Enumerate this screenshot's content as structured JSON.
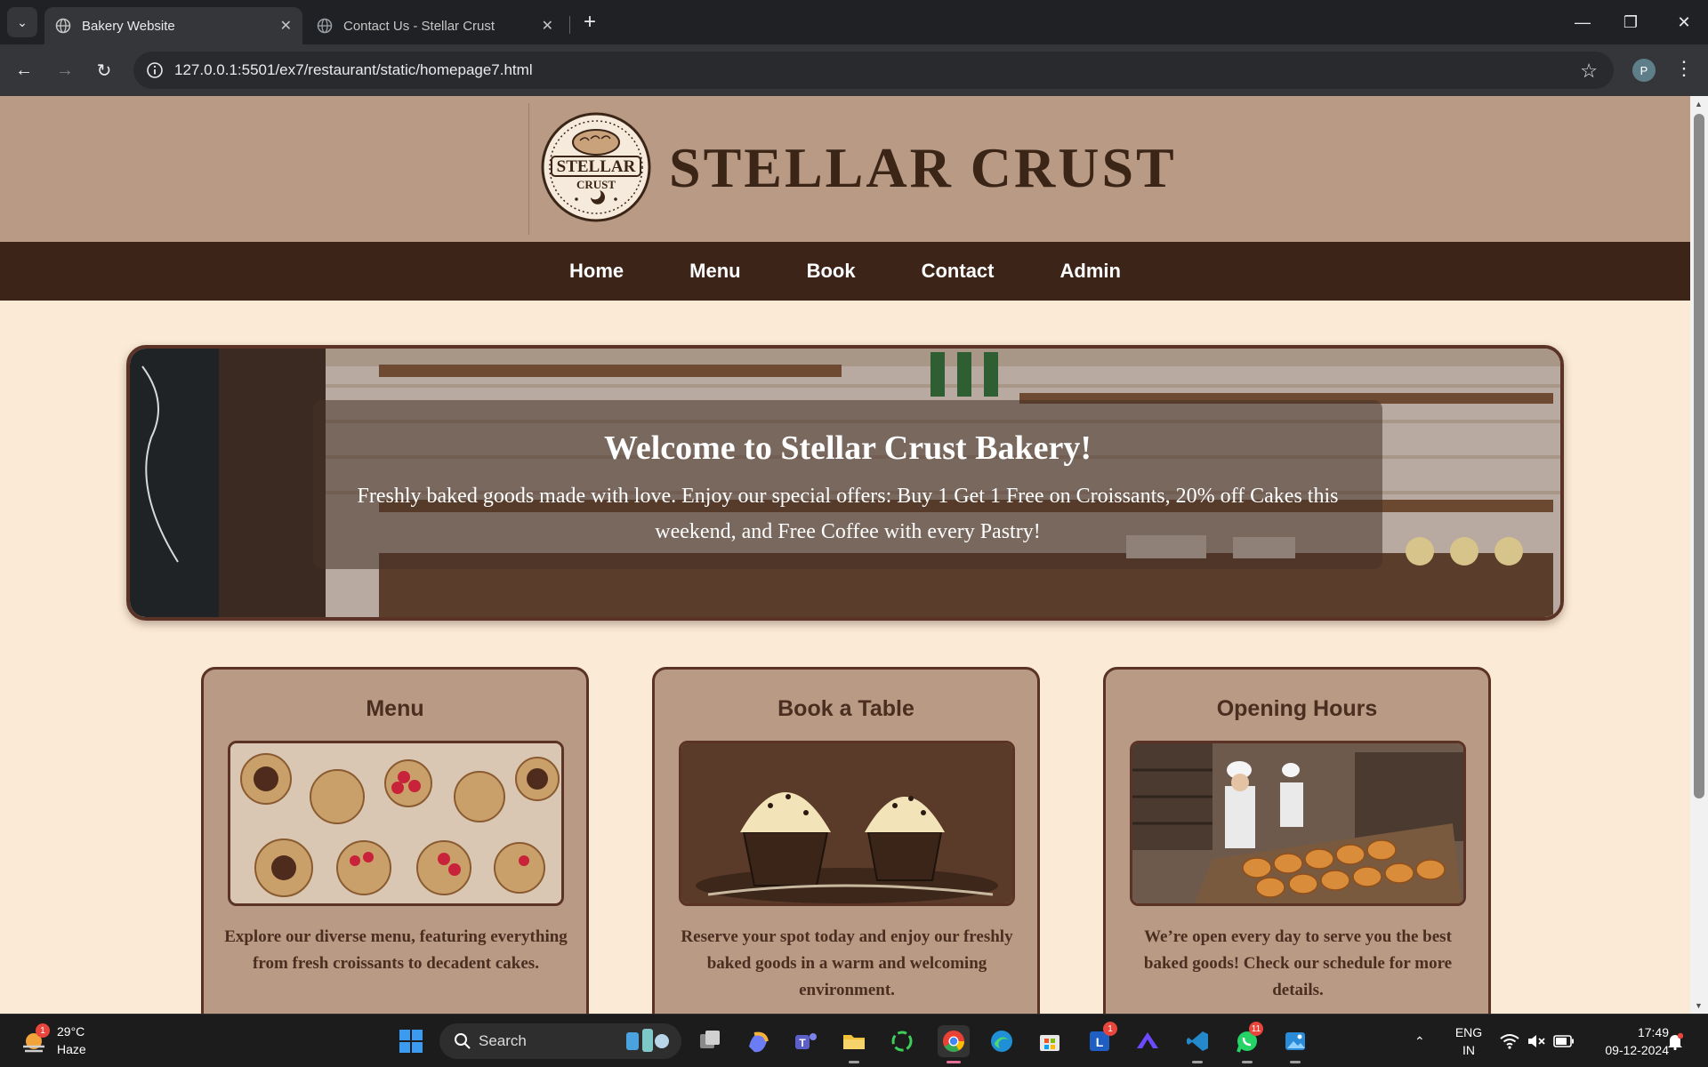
{
  "browser": {
    "tabs": [
      {
        "title": "Bakery Website",
        "active": true
      },
      {
        "title": "Contact Us - Stellar Crust",
        "active": false
      }
    ],
    "url": "127.0.0.1:5501/ex7/restaurant/static/homepage7.html",
    "profile_initial": "P"
  },
  "site": {
    "brand": "STELLAR CRUST",
    "logo_text": {
      "top": "STELLAR",
      "bottom": "CRUST"
    },
    "nav": [
      "Home",
      "Menu",
      "Book",
      "Contact",
      "Admin"
    ],
    "hero": {
      "title": "Welcome to Stellar Crust Bakery!",
      "text": "Freshly baked goods made with love. Enjoy our special offers: Buy 1 Get 1 Free on Croissants, 20% off Cakes this weekend, and Free Coffee with every Pastry!"
    },
    "cards": [
      {
        "title": "Menu",
        "text": "Explore our diverse menu, featuring everything from fresh croissants to decadent cakes."
      },
      {
        "title": "Book a Table",
        "text": "Reserve your spot today and enjoy our freshly baked goods in a warm and welcoming environment."
      },
      {
        "title": "Opening Hours",
        "text": "We’re open every day to serve you the best baked goods! Check our schedule for more details."
      }
    ]
  },
  "taskbar": {
    "weather": {
      "temp": "29°C",
      "condition": "Haze",
      "badge": "1"
    },
    "search_label": "Search",
    "badges": {
      "outlook": "1",
      "whatsapp": "11"
    },
    "language": {
      "line1": "ENG",
      "line2": "IN"
    },
    "clock": {
      "time": "17:49",
      "date": "09-12-2024"
    }
  },
  "colors": {
    "header_bg": "#b89a85",
    "nav_bg": "#3d2418",
    "page_bg": "#fbebd6",
    "card_border": "#5b3326",
    "brand_text": "#3b2517"
  }
}
